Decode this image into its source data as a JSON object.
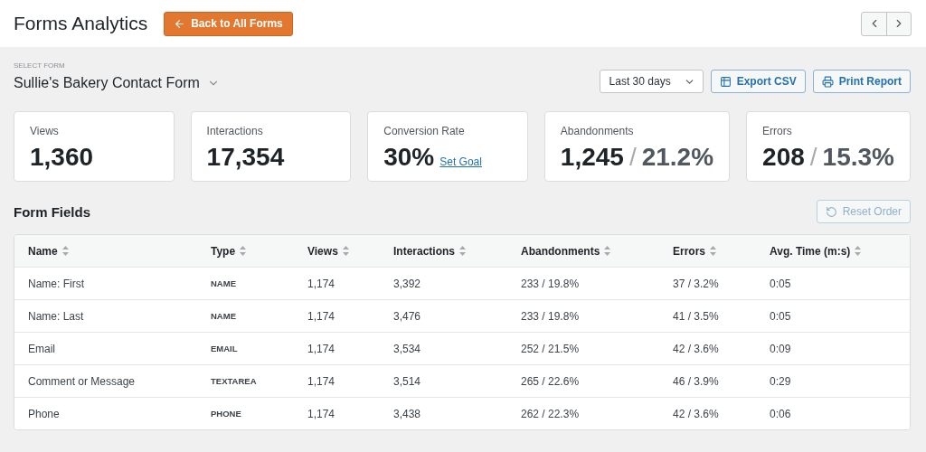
{
  "header": {
    "title": "Forms Analytics",
    "back_button": "Back to All Forms"
  },
  "form_select": {
    "label": "SELECT FORM",
    "value": "Sullie's Bakery Contact Form"
  },
  "date_range": {
    "value": "Last 30 days"
  },
  "actions": [
    {
      "label": "Export CSV",
      "kind": "export"
    },
    {
      "label": "Print Report",
      "kind": "print"
    }
  ],
  "stats": [
    {
      "label": "Views",
      "value": "1,360"
    },
    {
      "label": "Interactions",
      "value": "17,354"
    },
    {
      "label": "Conversion Rate",
      "value": "30%",
      "link": "Set Goal"
    },
    {
      "label": "Abandonments",
      "value": "1,245",
      "separator": "/",
      "secondary": "21.2%"
    },
    {
      "label": "Errors",
      "value": "208",
      "separator": "/",
      "secondary": "15.3%"
    }
  ],
  "form_fields": {
    "title": "Form Fields",
    "reset_button": {
      "label": "Reset Order",
      "disabled": true
    },
    "columns": [
      "Name",
      "Type",
      "Views",
      "Interactions",
      "Abandonments",
      "Errors",
      "Avg. Time (m:s)"
    ],
    "rows": [
      [
        "Name: First",
        "NAME",
        "1,174",
        "3,392",
        "233 / 19.8%",
        "37 / 3.2%",
        "0:05"
      ],
      [
        "Name: Last",
        "NAME",
        "1,174",
        "3,476",
        "233 / 19.8%",
        "41 / 3.5%",
        "0:05"
      ],
      [
        "Email",
        "EMAIL",
        "1,174",
        "3,534",
        "252 / 21.5%",
        "42 / 3.6%",
        "0:09"
      ],
      [
        "Comment or Message",
        "TEXTAREA",
        "1,174",
        "3,514",
        "265 / 22.6%",
        "46 / 3.9%",
        "0:29"
      ],
      [
        "Phone",
        "PHONE",
        "1,174",
        "3,438",
        "262 / 22.3%",
        "42 / 3.6%",
        "0:06"
      ]
    ]
  }
}
